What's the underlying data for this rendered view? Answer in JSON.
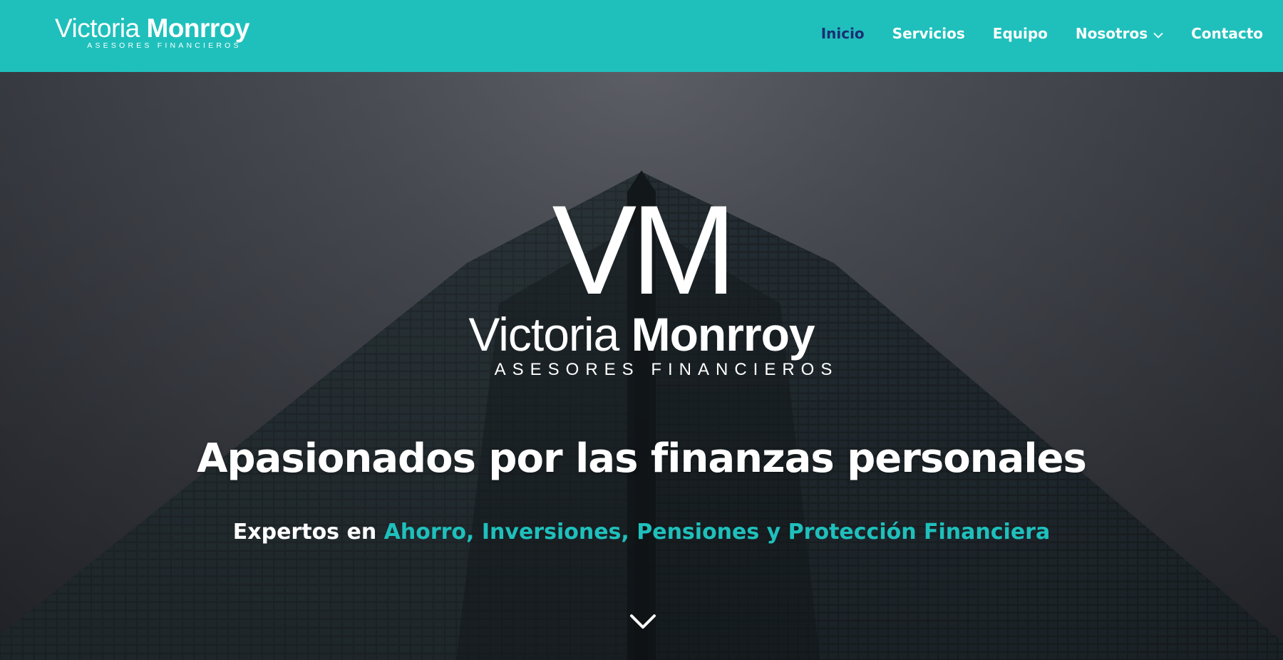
{
  "header": {
    "brand": {
      "first": "Victoria",
      "last": "Monrroy",
      "tagline": "ASESORES FINANCIEROS"
    },
    "nav": [
      {
        "label": "Inicio",
        "active": true
      },
      {
        "label": "Servicios"
      },
      {
        "label": "Equipo"
      },
      {
        "label": "Nosotros",
        "has_dropdown": true,
        "icon": "chevron-down-icon"
      },
      {
        "label": "Contacto"
      }
    ]
  },
  "hero": {
    "monogram": "VM",
    "name_first": "Victoria",
    "name_last": "Monrroy",
    "tagline": "ASESORES FINANCIEROS",
    "headline": "Apasionados por las finanzas personales",
    "subline_prefix": "Expertos en",
    "subline_highlight": "Ahorro, Inversiones, Pensiones y Protección Financiera",
    "scroll_icon": "chevron-down-icon"
  },
  "colors": {
    "accent": "#1fc0bc",
    "nav_active": "#1a2f73",
    "text_light": "#ffffff"
  }
}
